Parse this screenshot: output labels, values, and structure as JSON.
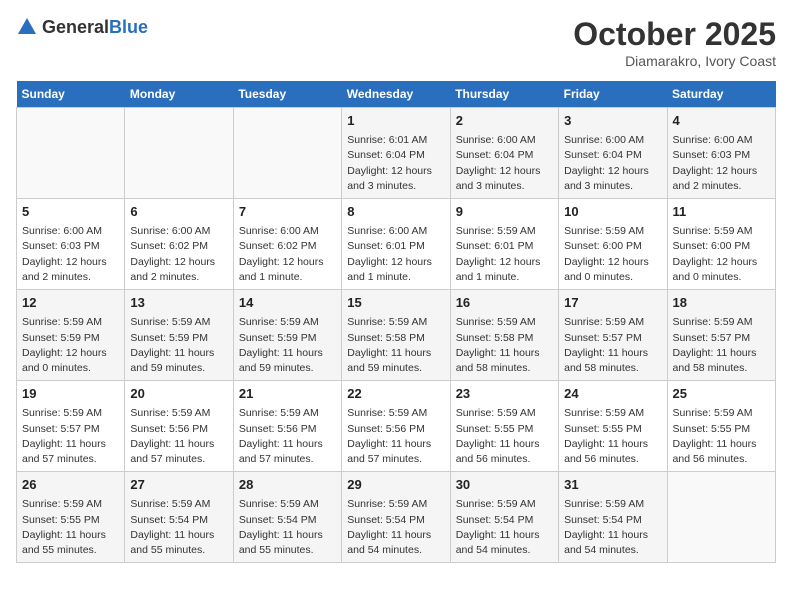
{
  "header": {
    "logo_general": "General",
    "logo_blue": "Blue",
    "month": "October 2025",
    "location": "Diamarakro, Ivory Coast"
  },
  "weekdays": [
    "Sunday",
    "Monday",
    "Tuesday",
    "Wednesday",
    "Thursday",
    "Friday",
    "Saturday"
  ],
  "weeks": [
    [
      {
        "day": "",
        "info": ""
      },
      {
        "day": "",
        "info": ""
      },
      {
        "day": "",
        "info": ""
      },
      {
        "day": "1",
        "info": "Sunrise: 6:01 AM\nSunset: 6:04 PM\nDaylight: 12 hours\nand 3 minutes."
      },
      {
        "day": "2",
        "info": "Sunrise: 6:00 AM\nSunset: 6:04 PM\nDaylight: 12 hours\nand 3 minutes."
      },
      {
        "day": "3",
        "info": "Sunrise: 6:00 AM\nSunset: 6:04 PM\nDaylight: 12 hours\nand 3 minutes."
      },
      {
        "day": "4",
        "info": "Sunrise: 6:00 AM\nSunset: 6:03 PM\nDaylight: 12 hours\nand 2 minutes."
      }
    ],
    [
      {
        "day": "5",
        "info": "Sunrise: 6:00 AM\nSunset: 6:03 PM\nDaylight: 12 hours\nand 2 minutes."
      },
      {
        "day": "6",
        "info": "Sunrise: 6:00 AM\nSunset: 6:02 PM\nDaylight: 12 hours\nand 2 minutes."
      },
      {
        "day": "7",
        "info": "Sunrise: 6:00 AM\nSunset: 6:02 PM\nDaylight: 12 hours\nand 1 minute."
      },
      {
        "day": "8",
        "info": "Sunrise: 6:00 AM\nSunset: 6:01 PM\nDaylight: 12 hours\nand 1 minute."
      },
      {
        "day": "9",
        "info": "Sunrise: 5:59 AM\nSunset: 6:01 PM\nDaylight: 12 hours\nand 1 minute."
      },
      {
        "day": "10",
        "info": "Sunrise: 5:59 AM\nSunset: 6:00 PM\nDaylight: 12 hours\nand 0 minutes."
      },
      {
        "day": "11",
        "info": "Sunrise: 5:59 AM\nSunset: 6:00 PM\nDaylight: 12 hours\nand 0 minutes."
      }
    ],
    [
      {
        "day": "12",
        "info": "Sunrise: 5:59 AM\nSunset: 5:59 PM\nDaylight: 12 hours\nand 0 minutes."
      },
      {
        "day": "13",
        "info": "Sunrise: 5:59 AM\nSunset: 5:59 PM\nDaylight: 11 hours\nand 59 minutes."
      },
      {
        "day": "14",
        "info": "Sunrise: 5:59 AM\nSunset: 5:59 PM\nDaylight: 11 hours\nand 59 minutes."
      },
      {
        "day": "15",
        "info": "Sunrise: 5:59 AM\nSunset: 5:58 PM\nDaylight: 11 hours\nand 59 minutes."
      },
      {
        "day": "16",
        "info": "Sunrise: 5:59 AM\nSunset: 5:58 PM\nDaylight: 11 hours\nand 58 minutes."
      },
      {
        "day": "17",
        "info": "Sunrise: 5:59 AM\nSunset: 5:57 PM\nDaylight: 11 hours\nand 58 minutes."
      },
      {
        "day": "18",
        "info": "Sunrise: 5:59 AM\nSunset: 5:57 PM\nDaylight: 11 hours\nand 58 minutes."
      }
    ],
    [
      {
        "day": "19",
        "info": "Sunrise: 5:59 AM\nSunset: 5:57 PM\nDaylight: 11 hours\nand 57 minutes."
      },
      {
        "day": "20",
        "info": "Sunrise: 5:59 AM\nSunset: 5:56 PM\nDaylight: 11 hours\nand 57 minutes."
      },
      {
        "day": "21",
        "info": "Sunrise: 5:59 AM\nSunset: 5:56 PM\nDaylight: 11 hours\nand 57 minutes."
      },
      {
        "day": "22",
        "info": "Sunrise: 5:59 AM\nSunset: 5:56 PM\nDaylight: 11 hours\nand 57 minutes."
      },
      {
        "day": "23",
        "info": "Sunrise: 5:59 AM\nSunset: 5:55 PM\nDaylight: 11 hours\nand 56 minutes."
      },
      {
        "day": "24",
        "info": "Sunrise: 5:59 AM\nSunset: 5:55 PM\nDaylight: 11 hours\nand 56 minutes."
      },
      {
        "day": "25",
        "info": "Sunrise: 5:59 AM\nSunset: 5:55 PM\nDaylight: 11 hours\nand 56 minutes."
      }
    ],
    [
      {
        "day": "26",
        "info": "Sunrise: 5:59 AM\nSunset: 5:55 PM\nDaylight: 11 hours\nand 55 minutes."
      },
      {
        "day": "27",
        "info": "Sunrise: 5:59 AM\nSunset: 5:54 PM\nDaylight: 11 hours\nand 55 minutes."
      },
      {
        "day": "28",
        "info": "Sunrise: 5:59 AM\nSunset: 5:54 PM\nDaylight: 11 hours\nand 55 minutes."
      },
      {
        "day": "29",
        "info": "Sunrise: 5:59 AM\nSunset: 5:54 PM\nDaylight: 11 hours\nand 54 minutes."
      },
      {
        "day": "30",
        "info": "Sunrise: 5:59 AM\nSunset: 5:54 PM\nDaylight: 11 hours\nand 54 minutes."
      },
      {
        "day": "31",
        "info": "Sunrise: 5:59 AM\nSunset: 5:54 PM\nDaylight: 11 hours\nand 54 minutes."
      },
      {
        "day": "",
        "info": ""
      }
    ]
  ]
}
